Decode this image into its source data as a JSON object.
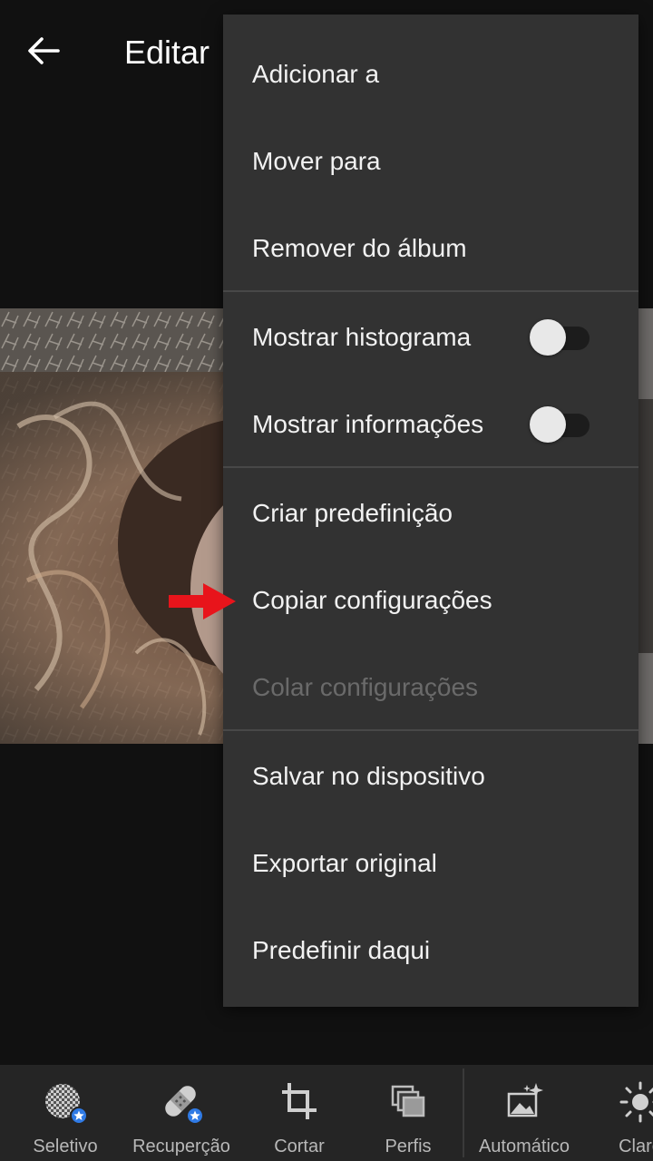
{
  "header": {
    "title": "Editar"
  },
  "menu": {
    "items": [
      {
        "label": "Adicionar a"
      },
      {
        "label": "Mover para"
      },
      {
        "label": "Remover do álbum"
      },
      {
        "label": "Mostrar histograma",
        "toggle_on": false
      },
      {
        "label": "Mostrar informações",
        "toggle_on": false
      },
      {
        "label": "Criar predefinição"
      },
      {
        "label": "Copiar configurações"
      },
      {
        "label": "Colar configurações",
        "disabled": true
      },
      {
        "label": "Salvar no dispositivo"
      },
      {
        "label": "Exportar original"
      },
      {
        "label": "Predefinir daqui"
      }
    ]
  },
  "toolbar": {
    "items": [
      {
        "label": "Seletivo",
        "icon": "selective-icon",
        "premium": true
      },
      {
        "label": "Recuperção",
        "icon": "healing-bandage-icon",
        "premium": true
      },
      {
        "label": "Cortar",
        "icon": "crop-icon"
      },
      {
        "label": "Perfis",
        "icon": "profiles-icon"
      },
      {
        "label": "Automático",
        "icon": "auto-icon"
      },
      {
        "label": "Claro",
        "icon": "light-icon"
      }
    ]
  },
  "colors": {
    "background": "#111111",
    "menu_background": "#323232",
    "toolbar_background": "#252525",
    "highlight_arrow": "#e8141b",
    "premium_badge": "#2f7ae5"
  }
}
